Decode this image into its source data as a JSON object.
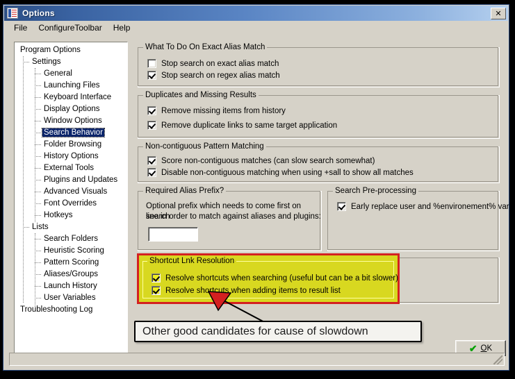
{
  "window": {
    "title": "Options",
    "icon": "options-checklist-icon",
    "close_label": "✕"
  },
  "menubar": {
    "items": [
      {
        "label": "File"
      },
      {
        "label": "ConfigureToolbar"
      },
      {
        "label": "Help"
      }
    ]
  },
  "tree": {
    "nodes": [
      {
        "label": "Program Options",
        "level": 0,
        "selected": false
      },
      {
        "label": "Settings",
        "level": 1,
        "selected": false
      },
      {
        "label": "General",
        "level": 2,
        "selected": false
      },
      {
        "label": "Launching Files",
        "level": 2,
        "selected": false
      },
      {
        "label": "Keyboard Interface",
        "level": 2,
        "selected": false
      },
      {
        "label": "Display Options",
        "level": 2,
        "selected": false
      },
      {
        "label": "Window Options",
        "level": 2,
        "selected": false
      },
      {
        "label": "Search Behavior",
        "level": 2,
        "selected": true
      },
      {
        "label": "Folder Browsing",
        "level": 2,
        "selected": false
      },
      {
        "label": "History Options",
        "level": 2,
        "selected": false
      },
      {
        "label": "External Tools",
        "level": 2,
        "selected": false
      },
      {
        "label": "Plugins and Updates",
        "level": 2,
        "selected": false
      },
      {
        "label": "Advanced Visuals",
        "level": 2,
        "selected": false
      },
      {
        "label": "Font Overrides",
        "level": 2,
        "selected": false
      },
      {
        "label": "Hotkeys",
        "level": 2,
        "selected": false
      },
      {
        "label": "Lists",
        "level": 1,
        "selected": false
      },
      {
        "label": "Search Folders",
        "level": 2,
        "selected": false
      },
      {
        "label": "Heuristic Scoring",
        "level": 2,
        "selected": false
      },
      {
        "label": "Pattern Scoring",
        "level": 2,
        "selected": false
      },
      {
        "label": "Aliases/Groups",
        "level": 2,
        "selected": false
      },
      {
        "label": "Launch History",
        "level": 2,
        "selected": false
      },
      {
        "label": "User Variables",
        "level": 2,
        "selected": false
      },
      {
        "label": "Troubleshooting Log",
        "level": 0,
        "selected": false
      }
    ]
  },
  "groups": {
    "exact_alias": {
      "title": "What To Do On Exact Alias Match",
      "checkboxes": [
        {
          "label": "Stop search on exact alias match",
          "checked": false
        },
        {
          "label": "Stop search on regex alias match",
          "checked": true
        }
      ]
    },
    "duplicates": {
      "title": "Duplicates and Missing Results",
      "checkboxes": [
        {
          "label": "Remove missing items from history",
          "checked": true
        },
        {
          "label": "Remove duplicate links to same target application",
          "checked": true
        }
      ]
    },
    "noncontiguous": {
      "title": "Non-contiguous Pattern Matching",
      "checkboxes": [
        {
          "label": "Score non-contiguous matches (can slow search somewhat)",
          "checked": true
        },
        {
          "label": "Disable non-contiguous matching when using +sall to show all matches",
          "checked": true
        }
      ]
    },
    "alias_prefix": {
      "title": "Required Alias Prefix?",
      "description_line1": "Optional prefix which needs to come first on search",
      "description_line2": "line in order to match against aliases and plugins:",
      "input_value": "",
      "input_placeholder": ""
    },
    "preprocessing": {
      "title": "Search Pre-processing",
      "checkboxes": [
        {
          "label": "Early replace user and %environement% vars",
          "checked": true
        }
      ]
    },
    "shortcut_resolution": {
      "title": "Shortcut Lnk Resolution",
      "highlight_border_color": "#d42020",
      "highlight_fill_color": "#d8d820",
      "checkboxes": [
        {
          "label": "Resolve shortcuts when searching (useful but can be a bit slower)",
          "checked": true
        },
        {
          "label": "Resolve shortcuts when adding items to result list",
          "checked": true
        }
      ]
    }
  },
  "annotation": {
    "callout_text": "Other good candidates for cause of slowdown",
    "arrow_color": "#d42020"
  },
  "buttons": {
    "ok_label": "OK",
    "ok_icon": "green-check-icon"
  }
}
